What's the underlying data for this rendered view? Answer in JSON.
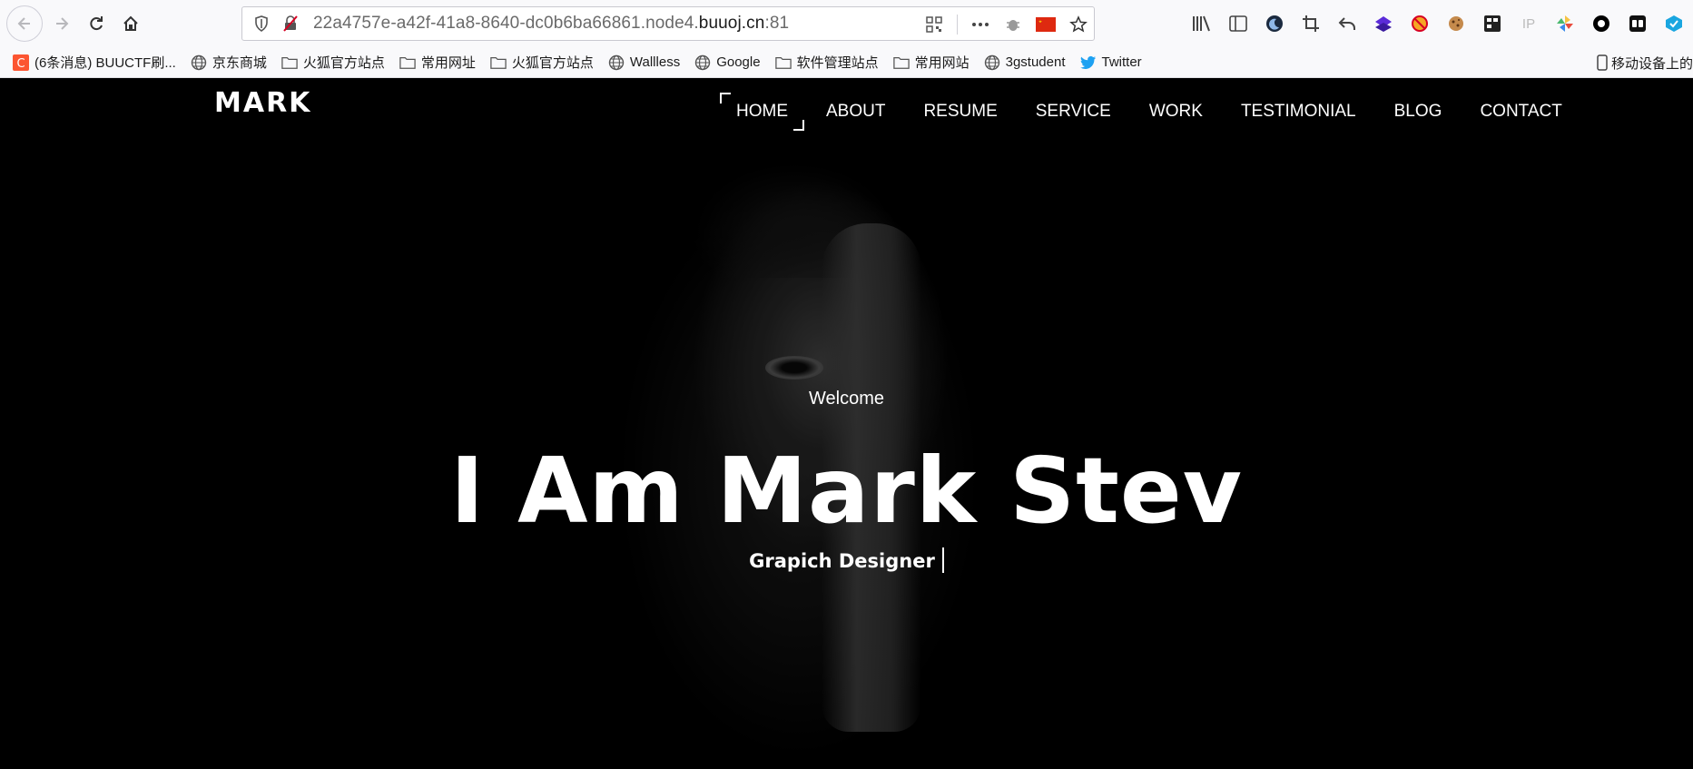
{
  "browser": {
    "url_prefix": "22a4757e-a42f-41a8-8640-dc0b6ba66861.node4.",
    "url_host": "buuoj.cn",
    "url_suffix": ":81",
    "mobile_label": "移动设备上的"
  },
  "bookmarks": [
    {
      "label": "(6条消息) BUUCTF刷...",
      "icon": "csdn-icon"
    },
    {
      "label": "京东商城",
      "icon": "globe-icon"
    },
    {
      "label": "火狐官方站点",
      "icon": "folder-icon"
    },
    {
      "label": "常用网址",
      "icon": "folder-icon"
    },
    {
      "label": "火狐官方站点",
      "icon": "folder-icon"
    },
    {
      "label": "Wallless",
      "icon": "globe-icon"
    },
    {
      "label": "Google",
      "icon": "globe-icon"
    },
    {
      "label": "软件管理站点",
      "icon": "folder-icon"
    },
    {
      "label": "常用网站",
      "icon": "folder-icon"
    },
    {
      "label": "3gstudent",
      "icon": "globe-icon"
    },
    {
      "label": "Twitter",
      "icon": "twitter-icon"
    }
  ],
  "site": {
    "logo": "MARK",
    "nav": [
      "HOME",
      "ABOUT",
      "RESUME",
      "SERVICE",
      "WORK",
      "TESTIMONIAL",
      "BLOG",
      "CONTACT"
    ],
    "active_nav": "HOME",
    "welcome": "Welcome",
    "headline": "I Am Mark Stev",
    "subline": "Grapich Designer"
  },
  "colors": {
    "page_bg": "#000000",
    "text": "#ffffff",
    "chrome_bg": "#f9f9fb"
  }
}
